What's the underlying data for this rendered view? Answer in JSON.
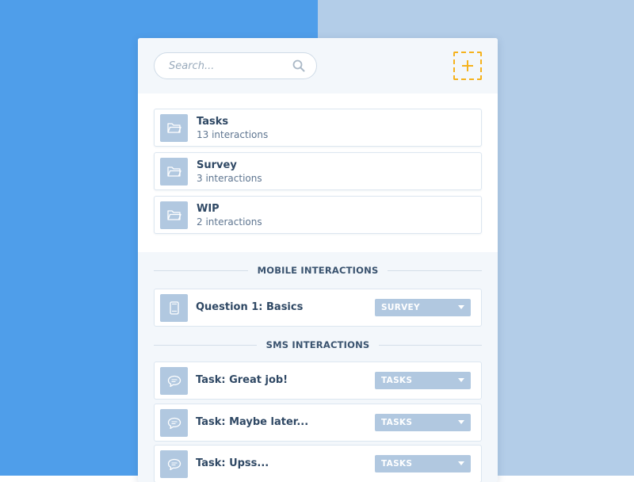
{
  "header": {
    "search_placeholder": "Search...",
    "search_icon": "search-icon",
    "add_icon": "plus-icon",
    "accent_color": "#f5b21d"
  },
  "folders": [
    {
      "name": "Tasks",
      "count": "13 interactions",
      "icon": "folder-icon"
    },
    {
      "name": "Survey",
      "count": "3 interactions",
      "icon": "folder-icon"
    },
    {
      "name": "WIP",
      "count": "2 interactions",
      "icon": "folder-icon"
    }
  ],
  "mobile": {
    "title": "MOBILE INTERACTIONS",
    "items": [
      {
        "name": "Question 1: Basics",
        "folder": "SURVEY",
        "icon": "mobile-phone-icon"
      }
    ]
  },
  "sms": {
    "title": "SMS INTERACTIONS",
    "items": [
      {
        "name": "Task: Great job!",
        "folder": "TASKS",
        "icon": "chat-bubble-icon"
      },
      {
        "name": "Task: Maybe later...",
        "folder": "TASKS",
        "icon": "chat-bubble-icon"
      },
      {
        "name": "Task: Upss...",
        "folder": "TASKS",
        "icon": "chat-bubble-icon"
      }
    ]
  },
  "colors": {
    "background_left": "#4f9eea",
    "background_right": "#b3cde8",
    "thumbnail": "#b1c8e0",
    "text_dark": "#2f4864"
  }
}
